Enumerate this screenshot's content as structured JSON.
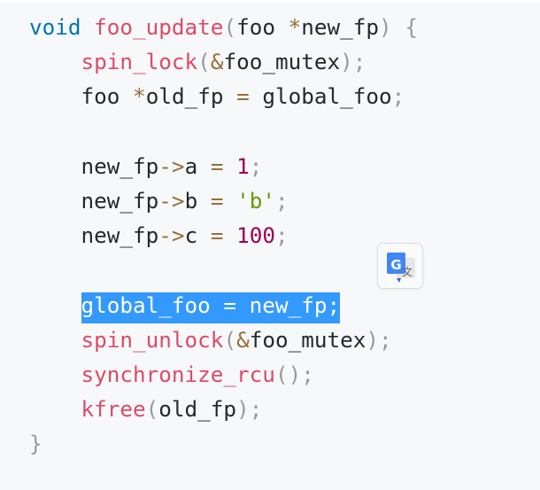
{
  "code": {
    "kw_void": "void",
    "fn_name": "foo_update",
    "type_foo": "foo",
    "star": "*",
    "param_name": "new_fp",
    "open_paren": "(",
    "close_paren": ")",
    "open_brace": "{",
    "close_brace": "}",
    "indent": "    ",
    "spin_lock": "spin_lock",
    "amp": "&",
    "foo_mutex": "foo_mutex",
    "semi": ";",
    "old_fp": "old_fp",
    "eq": "=",
    "global_foo": "global_foo",
    "new_fp": "new_fp",
    "arrow": "->",
    "field_a": "a",
    "field_b": "b",
    "field_c": "c",
    "num_1": "1",
    "str_b": "'b'",
    "num_100": "100",
    "selected_line": "global_foo = new_fp;",
    "spin_unlock": "spin_unlock",
    "synchronize_rcu": "synchronize_rcu",
    "kfree": "kfree"
  },
  "translate_button": {
    "icon": "google-translate-icon",
    "icon_letter": "G",
    "icon_glyph": "文"
  },
  "colors": {
    "background": "#f6f8fa",
    "keyword": "#0077aa",
    "function": "#dd4a68",
    "operator": "#9a6e3a",
    "punctuation": "#999999",
    "number": "#990055",
    "string": "#669900",
    "selection": "#3399ff"
  }
}
